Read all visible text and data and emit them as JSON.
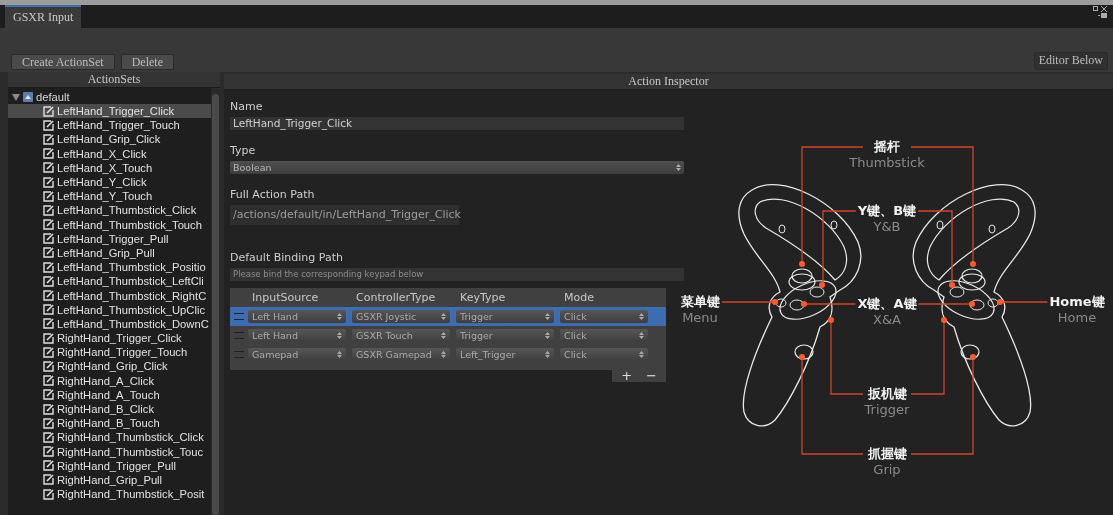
{
  "window": {
    "tab": {
      "label": "GSXR Input",
      "selected": true
    }
  },
  "toolbar": {
    "buttons": [
      "Create ActionSet",
      "Delete"
    ],
    "right_button": "Editor Below"
  },
  "action_sets": {
    "title": "ActionSets",
    "tree": [
      {
        "label": "default",
        "expanded": true,
        "children": [
          {
            "label": "LeftHand_Trigger_Click",
            "selected": true
          },
          {
            "label": "LeftHand_Trigger_Touch",
            "selected": false
          },
          {
            "label": "LeftHand_Grip_Click",
            "selected": false
          },
          {
            "label": "LeftHand_X_Click",
            "selected": false
          },
          {
            "label": "LeftHand_X_Touch",
            "selected": false
          },
          {
            "label": "LeftHand_Y_Click",
            "selected": false
          },
          {
            "label": "LeftHand_Y_Touch",
            "selected": false
          },
          {
            "label": "LeftHand_Thumbstick_Click",
            "selected": false
          },
          {
            "label": "LeftHand_Thumbstick_Touch",
            "selected": false
          },
          {
            "label": "LeftHand_Trigger_Pull",
            "selected": false
          },
          {
            "label": "LeftHand_Grip_Pull",
            "selected": false
          },
          {
            "label": "LeftHand_Thumbstick_Positio",
            "selected": false
          },
          {
            "label": "LeftHand_Thumbstick_LeftCli",
            "selected": false
          },
          {
            "label": "LeftHand_Thumbstick_RightC",
            "selected": false
          },
          {
            "label": "LeftHand_Thumbstick_UpClic",
            "selected": false
          },
          {
            "label": "LeftHand_Thumbstick_DownC",
            "selected": false
          },
          {
            "label": "RightHand_Trigger_Click",
            "selected": false
          },
          {
            "label": "RightHand_Trigger_Touch",
            "selected": false
          },
          {
            "label": "RightHand_Grip_Click",
            "selected": false
          },
          {
            "label": "RightHand_A_Click",
            "selected": false
          },
          {
            "label": "RightHand_A_Touch",
            "selected": false
          },
          {
            "label": "RightHand_B_Click",
            "selected": false
          },
          {
            "label": "RightHand_B_Touch",
            "selected": false
          },
          {
            "label": "RightHand_Thumbstick_Click",
            "selected": false
          },
          {
            "label": "RightHand_Thumbstick_Touc",
            "selected": false
          },
          {
            "label": "RightHand_Trigger_Pull",
            "selected": false
          },
          {
            "label": "RightHand_Grip_Pull",
            "selected": false
          },
          {
            "label": "RightHand_Thumbstick_Posit",
            "selected": false
          }
        ]
      }
    ]
  },
  "inspector": {
    "title": "Action Inspector",
    "fields": [
      {
        "kind": "text",
        "label": "Name",
        "value": "LeftHand_Trigger_Click"
      },
      {
        "kind": "dropdown",
        "label": "Type",
        "value": "Boolean"
      },
      {
        "kind": "readonly",
        "label": "Full Action Path",
        "value": "/actions/default/in/LeftHand_Trigger_Click"
      },
      {
        "kind": "hint",
        "label": "Default Binding Path",
        "placeholder": "Please bind the corresponding keypad below"
      }
    ],
    "bindings": {
      "columns": [
        "InputSource",
        "ControllerType",
        "KeyType",
        "Mode"
      ],
      "rows": [
        {
          "selected": true,
          "cells": [
            "Left Hand",
            "GSXR Joystic",
            "Trigger",
            "Click"
          ]
        },
        {
          "selected": false,
          "cells": [
            "Left Hand",
            "GSXR Touch",
            "Trigger",
            "Click"
          ]
        },
        {
          "selected": false,
          "cells": [
            "Gamepad",
            "GSXR Gamepad",
            "Left_Trigger",
            "Click"
          ]
        }
      ],
      "add_button": "+",
      "remove_button": "−"
    }
  },
  "diagram": {
    "callouts": [
      {
        "zh": "摇杆",
        "en": "Thumbstick"
      },
      {
        "zh": "Y键、B键",
        "en": "Y&B"
      },
      {
        "zh": "菜单键",
        "en": "Menu"
      },
      {
        "zh": "X键、A键",
        "en": "X&A"
      },
      {
        "zh": "Home键",
        "en": "Home"
      },
      {
        "zh": "扳机键",
        "en": "Trigger"
      },
      {
        "zh": "抓握键",
        "en": "Grip"
      }
    ]
  }
}
